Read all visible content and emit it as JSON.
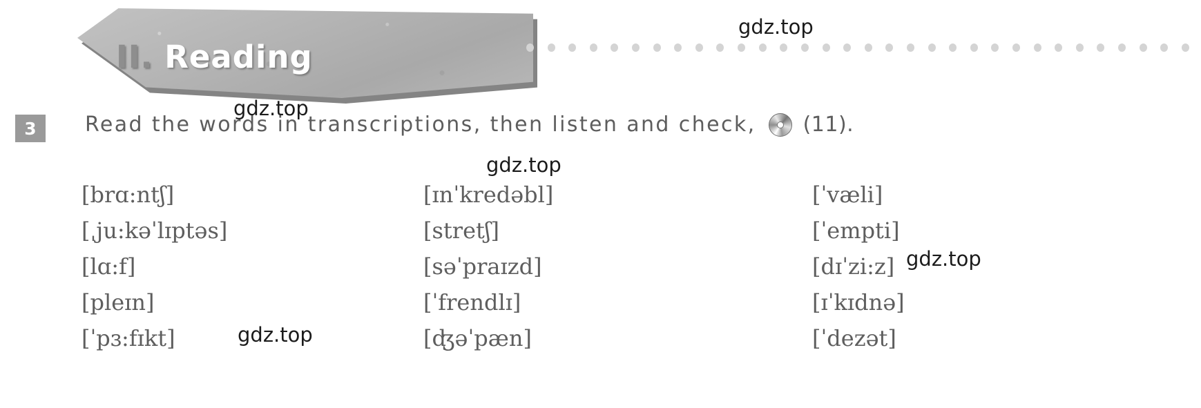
{
  "banner": {
    "numeral": "II.",
    "title": "Reading"
  },
  "dot_rule": {
    "dot_count": 32,
    "color": "#d4d4d4"
  },
  "exercise": {
    "number": "3",
    "instruction_before_icon": "Read  the  words  in  transcriptions,  then  listen  and  check,",
    "audio_icon": "cd-icon",
    "track_label": "(11)."
  },
  "columns": [
    {
      "name": "column-1",
      "items": [
        "[brɑ:ntʃ]",
        "[ˌju:kəˈlɪptəs]",
        "[lɑ:f]",
        "[pleɪn]",
        "[ˈpɜ:fɪkt]"
      ]
    },
    {
      "name": "column-2",
      "items": [
        "[ɪnˈkredəbl]",
        "[stretʃ]",
        "[səˈpraɪzd]",
        "[ˈfrendlɪ]",
        "[ʤəˈpæn]"
      ]
    },
    {
      "name": "column-3",
      "items": [
        "[ˈvæli]",
        "[ˈempti]",
        "[dɪˈzi:z]",
        "[ɪˈkɪdnə]",
        "[ˈdezət]"
      ]
    }
  ],
  "watermarks": {
    "text": "gdz.top",
    "instances": [
      "gdz.top",
      "gdz.top",
      "gdz.top",
      "gdz.top",
      "gdz.top"
    ]
  },
  "colors": {
    "banner_gray": "#b4b4b4",
    "banner_shadow": "#6e6e6e",
    "number_box": "#9a9a9a",
    "body_text": "#5d5d5d",
    "transcription_text": "#5e5e5e",
    "page_background": "#ffffff"
  }
}
